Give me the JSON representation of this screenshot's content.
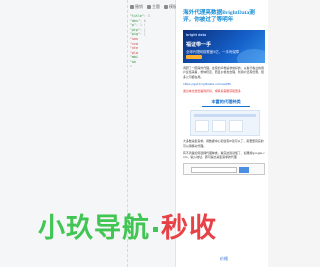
{
  "editor": {
    "toolbar": {
      "items": [
        "撤销",
        "主题",
        "模板"
      ]
    },
    "code_lines": [
      {
        "k": "\"title\"",
        "v": ": 5"
      },
      {
        "k": "\"des\"",
        "v": ": 6"
      },
      {
        "k": "\"p\"",
        "v": ": 1 ("
      },
      {
        "k": "\"ptp\"",
        "v": ": ["
      },
      {
        "k": "\"pig\"",
        "v": ": ["
      },
      {
        "k": "\"",
        "v": "sen"
      },
      {
        "k": "\"",
        "v": "cca"
      },
      {
        "k": "\"",
        "v": "xte"
      },
      {
        "k": "\"",
        "v": "pla"
      },
      {
        "k": "\"",
        "v": "mbi"
      },
      {
        "k": "\"",
        "v": "wh"
      },
      {
        "k": "\"",
        "v": ""
      }
    ]
  },
  "preview": {
    "title": "海外代理亮数据BrightData测评，你被过了等明年",
    "banner": {
      "brand": "bright data",
      "line1": "福证带一手",
      "line2": "全球代理网络覆盖5亿，一手有保障"
    },
    "para1": "调研了一圈海外代理，这家的声誉是非常好的，从各行各业的用户反馈来看，整体稳定，而且价格也合理，新用户还有优惠，很多公司都在用。",
    "link": "https://get.brightdata.com/ewt8h",
    "red": "通过本文送您福利折扣，或联系客服获取更多",
    "section": "丰富的代理种类",
    "para2": "大多数采集需求，用数据中心和住宅IP就可以了，需要更真实的可以用移动代理。",
    "para3": "有不清楚如何选择代理种类，看完这篇就懂了，如果搜google.com，输入地址，即可提交采集需求的代理",
    "footer": "价格"
  },
  "watermark": {
    "green": "小玖导航",
    "red": "秒",
    "tail": "收"
  }
}
